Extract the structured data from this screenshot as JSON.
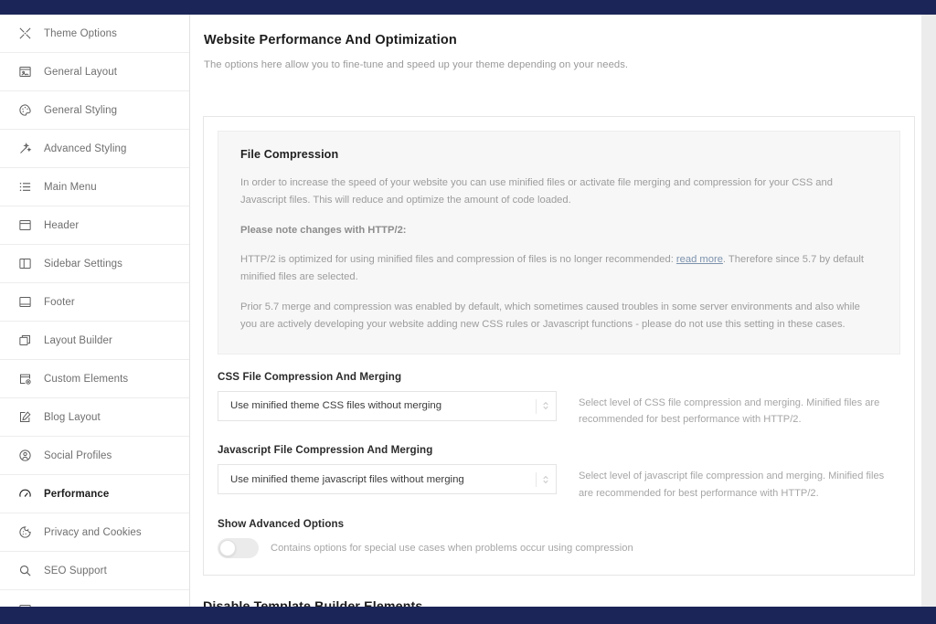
{
  "window": {
    "top_bar_color": "#1b2557",
    "bottom_bar_color": "#1b2557"
  },
  "sidebar": {
    "items": [
      {
        "label": "Theme Options",
        "icon": "tools-icon",
        "active": false
      },
      {
        "label": "General Layout",
        "icon": "layout-image-icon",
        "active": false
      },
      {
        "label": "General Styling",
        "icon": "palette-icon",
        "active": false
      },
      {
        "label": "Advanced Styling",
        "icon": "magic-wand-icon",
        "active": false
      },
      {
        "label": "Main Menu",
        "icon": "list-icon",
        "active": false
      },
      {
        "label": "Header",
        "icon": "header-box-icon",
        "active": false
      },
      {
        "label": "Sidebar Settings",
        "icon": "sidebar-columns-icon",
        "active": false
      },
      {
        "label": "Footer",
        "icon": "footer-box-icon",
        "active": false
      },
      {
        "label": "Layout Builder",
        "icon": "stacked-layers-icon",
        "active": false
      },
      {
        "label": "Custom Elements",
        "icon": "add-element-icon",
        "active": false
      },
      {
        "label": "Blog Layout",
        "icon": "edit-page-icon",
        "active": false
      },
      {
        "label": "Social Profiles",
        "icon": "user-circle-icon",
        "active": false
      },
      {
        "label": "Performance",
        "icon": "gauge-icon",
        "active": true
      },
      {
        "label": "Privacy and Cookies",
        "icon": "cookie-icon",
        "active": false
      },
      {
        "label": "SEO Support",
        "icon": "search-icon",
        "active": false
      }
    ]
  },
  "page": {
    "title": "Website Performance And Optimization",
    "subtitle": "The options here allow you to fine-tune and speed up your theme depending on your needs."
  },
  "notice": {
    "heading": "File Compression",
    "paragraph1": "In order to increase the speed of your website you can use minified files or activate file merging and compression for your CSS and Javascript files. This will reduce and optimize the amount of code loaded.",
    "paragraph2": "Please note changes with HTTP/2:",
    "paragraph3_before": "HTTP/2 is optimized for using minified files and compression of files is no longer recommended: ",
    "paragraph3_link": "read more",
    "paragraph3_after": ". Therefore since 5.7 by default minified files are selected.",
    "paragraph4": "Prior 5.7 merge and compression was enabled by default, which sometimes caused troubles in some server environments and also while you are actively developing your website adding new CSS rules or Javascript functions - please do not use this setting in these cases.",
    "link_color": "#7c92ad"
  },
  "fields": {
    "css": {
      "label": "CSS File Compression And Merging",
      "value": "Use minified theme CSS files without merging",
      "help": "Select level of CSS file compression and merging. Minified files are recommended for best performance with HTTP/2."
    },
    "javascript": {
      "label": "Javascript File Compression And Merging",
      "value": "Use minified theme javascript files without merging",
      "help": "Select level of javascript file compression and merging. Minified files are recommended for best performance with HTTP/2."
    },
    "advanced": {
      "label": "Show Advanced Options",
      "toggle_state": "off",
      "help": "Contains options for special use cases when problems occur using compression"
    }
  },
  "bottom_section": {
    "heading": "Disable Template Builder Elements"
  }
}
